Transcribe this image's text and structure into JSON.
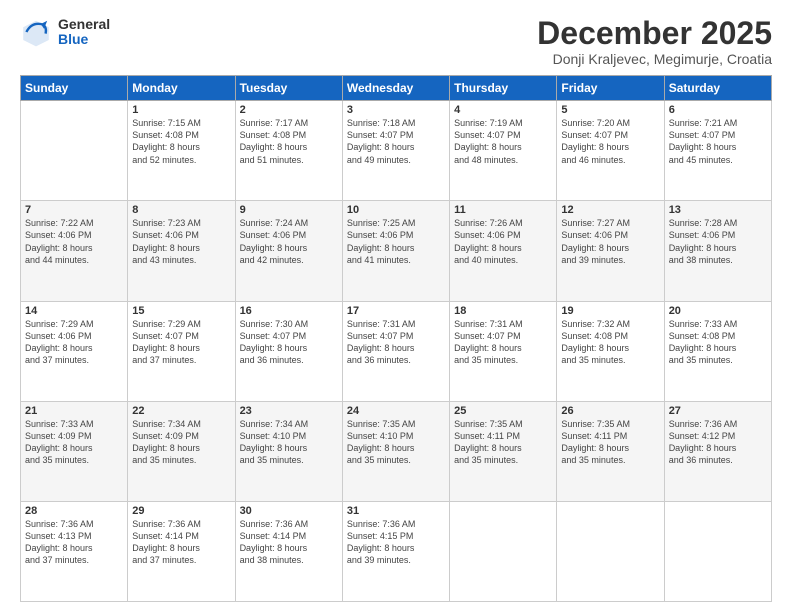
{
  "header": {
    "logo_general": "General",
    "logo_blue": "Blue",
    "month_title": "December 2025",
    "subtitle": "Donji Kraljevec, Megimurje, Croatia"
  },
  "days_of_week": [
    "Sunday",
    "Monday",
    "Tuesday",
    "Wednesday",
    "Thursday",
    "Friday",
    "Saturday"
  ],
  "weeks": [
    [
      {
        "day": "",
        "text": ""
      },
      {
        "day": "1",
        "text": "Sunrise: 7:15 AM\nSunset: 4:08 PM\nDaylight: 8 hours\nand 52 minutes."
      },
      {
        "day": "2",
        "text": "Sunrise: 7:17 AM\nSunset: 4:08 PM\nDaylight: 8 hours\nand 51 minutes."
      },
      {
        "day": "3",
        "text": "Sunrise: 7:18 AM\nSunset: 4:07 PM\nDaylight: 8 hours\nand 49 minutes."
      },
      {
        "day": "4",
        "text": "Sunrise: 7:19 AM\nSunset: 4:07 PM\nDaylight: 8 hours\nand 48 minutes."
      },
      {
        "day": "5",
        "text": "Sunrise: 7:20 AM\nSunset: 4:07 PM\nDaylight: 8 hours\nand 46 minutes."
      },
      {
        "day": "6",
        "text": "Sunrise: 7:21 AM\nSunset: 4:07 PM\nDaylight: 8 hours\nand 45 minutes."
      }
    ],
    [
      {
        "day": "7",
        "text": "Sunrise: 7:22 AM\nSunset: 4:06 PM\nDaylight: 8 hours\nand 44 minutes."
      },
      {
        "day": "8",
        "text": "Sunrise: 7:23 AM\nSunset: 4:06 PM\nDaylight: 8 hours\nand 43 minutes."
      },
      {
        "day": "9",
        "text": "Sunrise: 7:24 AM\nSunset: 4:06 PM\nDaylight: 8 hours\nand 42 minutes."
      },
      {
        "day": "10",
        "text": "Sunrise: 7:25 AM\nSunset: 4:06 PM\nDaylight: 8 hours\nand 41 minutes."
      },
      {
        "day": "11",
        "text": "Sunrise: 7:26 AM\nSunset: 4:06 PM\nDaylight: 8 hours\nand 40 minutes."
      },
      {
        "day": "12",
        "text": "Sunrise: 7:27 AM\nSunset: 4:06 PM\nDaylight: 8 hours\nand 39 minutes."
      },
      {
        "day": "13",
        "text": "Sunrise: 7:28 AM\nSunset: 4:06 PM\nDaylight: 8 hours\nand 38 minutes."
      }
    ],
    [
      {
        "day": "14",
        "text": "Sunrise: 7:29 AM\nSunset: 4:06 PM\nDaylight: 8 hours\nand 37 minutes."
      },
      {
        "day": "15",
        "text": "Sunrise: 7:29 AM\nSunset: 4:07 PM\nDaylight: 8 hours\nand 37 minutes."
      },
      {
        "day": "16",
        "text": "Sunrise: 7:30 AM\nSunset: 4:07 PM\nDaylight: 8 hours\nand 36 minutes."
      },
      {
        "day": "17",
        "text": "Sunrise: 7:31 AM\nSunset: 4:07 PM\nDaylight: 8 hours\nand 36 minutes."
      },
      {
        "day": "18",
        "text": "Sunrise: 7:31 AM\nSunset: 4:07 PM\nDaylight: 8 hours\nand 35 minutes."
      },
      {
        "day": "19",
        "text": "Sunrise: 7:32 AM\nSunset: 4:08 PM\nDaylight: 8 hours\nand 35 minutes."
      },
      {
        "day": "20",
        "text": "Sunrise: 7:33 AM\nSunset: 4:08 PM\nDaylight: 8 hours\nand 35 minutes."
      }
    ],
    [
      {
        "day": "21",
        "text": "Sunrise: 7:33 AM\nSunset: 4:09 PM\nDaylight: 8 hours\nand 35 minutes."
      },
      {
        "day": "22",
        "text": "Sunrise: 7:34 AM\nSunset: 4:09 PM\nDaylight: 8 hours\nand 35 minutes."
      },
      {
        "day": "23",
        "text": "Sunrise: 7:34 AM\nSunset: 4:10 PM\nDaylight: 8 hours\nand 35 minutes."
      },
      {
        "day": "24",
        "text": "Sunrise: 7:35 AM\nSunset: 4:10 PM\nDaylight: 8 hours\nand 35 minutes."
      },
      {
        "day": "25",
        "text": "Sunrise: 7:35 AM\nSunset: 4:11 PM\nDaylight: 8 hours\nand 35 minutes."
      },
      {
        "day": "26",
        "text": "Sunrise: 7:35 AM\nSunset: 4:11 PM\nDaylight: 8 hours\nand 35 minutes."
      },
      {
        "day": "27",
        "text": "Sunrise: 7:36 AM\nSunset: 4:12 PM\nDaylight: 8 hours\nand 36 minutes."
      }
    ],
    [
      {
        "day": "28",
        "text": "Sunrise: 7:36 AM\nSunset: 4:13 PM\nDaylight: 8 hours\nand 37 minutes."
      },
      {
        "day": "29",
        "text": "Sunrise: 7:36 AM\nSunset: 4:14 PM\nDaylight: 8 hours\nand 37 minutes."
      },
      {
        "day": "30",
        "text": "Sunrise: 7:36 AM\nSunset: 4:14 PM\nDaylight: 8 hours\nand 38 minutes."
      },
      {
        "day": "31",
        "text": "Sunrise: 7:36 AM\nSunset: 4:15 PM\nDaylight: 8 hours\nand 39 minutes."
      },
      {
        "day": "",
        "text": ""
      },
      {
        "day": "",
        "text": ""
      },
      {
        "day": "",
        "text": ""
      }
    ]
  ]
}
